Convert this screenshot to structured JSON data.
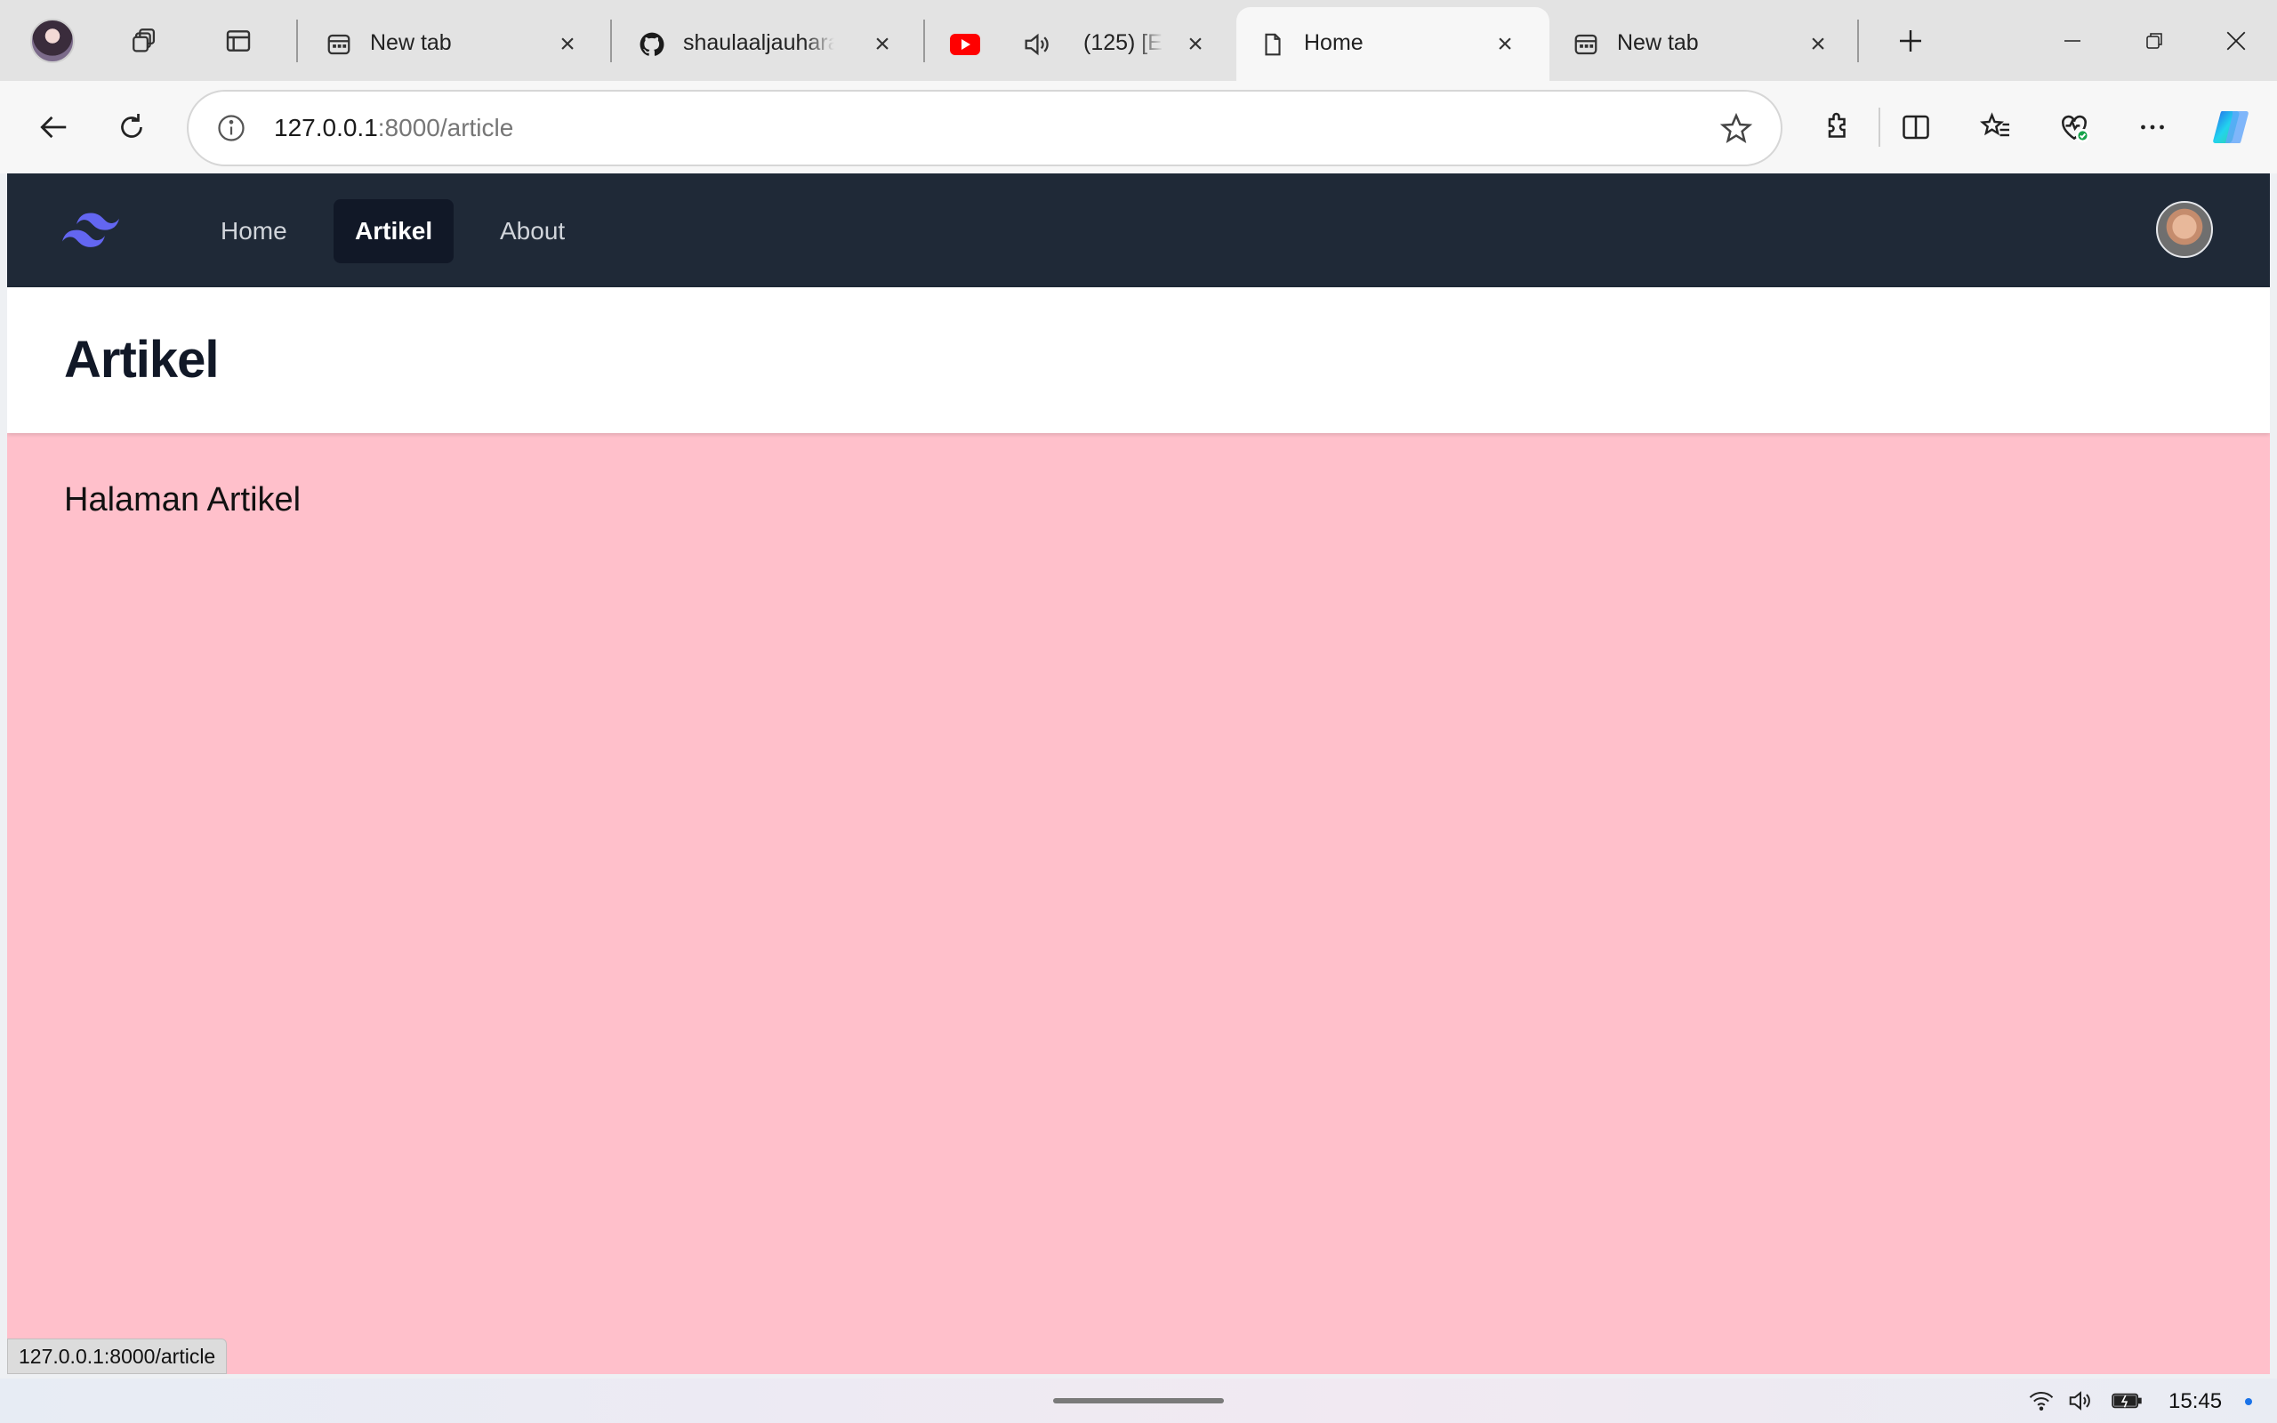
{
  "browser": {
    "tabs": [
      {
        "label": "New tab",
        "icon": "new-tab-page-icon"
      },
      {
        "label": "shaulaaljauhara",
        "icon": "github-icon"
      },
      {
        "label": "(125) [E",
        "icon": "youtube-icon"
      },
      {
        "label": "Home",
        "icon": "document-icon",
        "active": true
      },
      {
        "label": "New tab",
        "icon": "new-tab-page-icon"
      }
    ],
    "address": {
      "host": "127.0.0.1",
      "path": ":8000/article"
    },
    "status_url": "127.0.0.1:8000/article"
  },
  "navbar": {
    "links": [
      "Home",
      "Artikel",
      "About"
    ],
    "active": "Artikel"
  },
  "header": {
    "title": "Artikel"
  },
  "main": {
    "text": "Halaman Artikel"
  },
  "taskbar": {
    "time": "15:45"
  },
  "colors": {
    "navbar_bg": "#1f2937",
    "nav_active_bg": "#111827",
    "page_bg": "#ffc0cb",
    "logo_accent": "#6366f1"
  }
}
